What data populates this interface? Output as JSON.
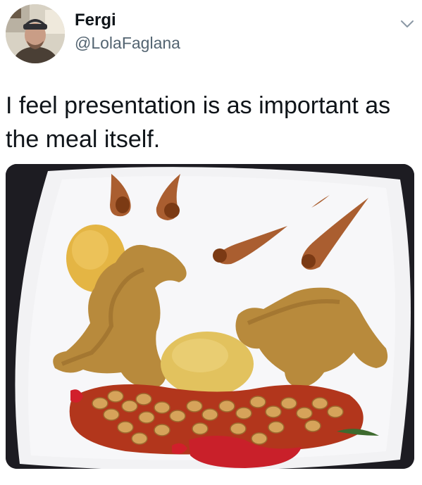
{
  "author": {
    "display_name": "Fergi",
    "handle": "@LolaFaglana"
  },
  "tweet": {
    "text": "I feel presentation is as important as the meal itself."
  },
  "icons": {
    "avatar": "profile-photo",
    "menu": "chevron-down-icon"
  },
  "colors": {
    "text_primary": "#0f1419",
    "text_secondary": "#536471",
    "chevron": "#8b98a5"
  }
}
